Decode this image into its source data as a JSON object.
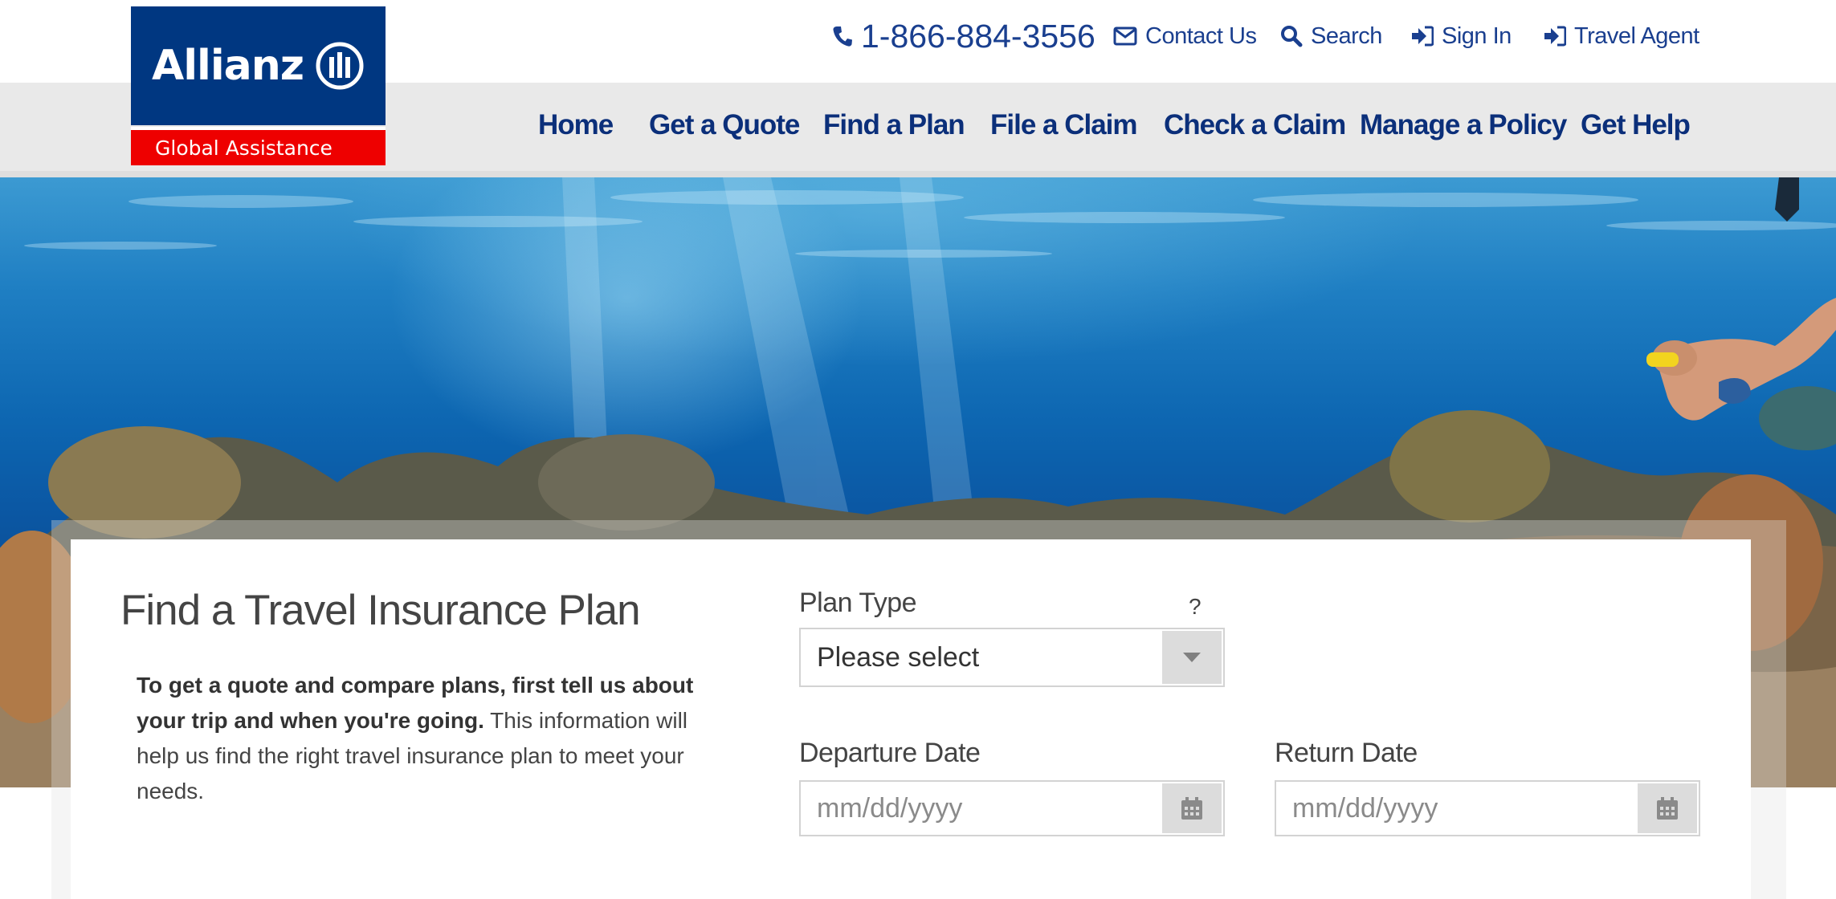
{
  "brand": {
    "name": "Allianz",
    "sub": "Global Assistance",
    "blue": "#003781",
    "red": "#ee0000"
  },
  "utility": {
    "phone": "1-866-884-3556",
    "contact": "Contact Us",
    "search": "Search",
    "sign_in": "Sign In",
    "travel_agent": "Travel Agent",
    "icons": [
      "phone-icon",
      "envelope-icon",
      "search-icon",
      "sign-in-icon",
      "sign-in-icon"
    ]
  },
  "nav": {
    "items": [
      "Home",
      "Get a Quote",
      "Find a Plan",
      "File a Claim",
      "Check a Claim",
      "Manage a Policy",
      "Get Help"
    ],
    "color": "#0b2f7a"
  },
  "form": {
    "title": "Find a Travel Insurance Plan",
    "desc_bold": "To get a quote and compare plans, first tell us about your trip and when you're going.",
    "desc_rest": " This information will help us find the right travel insurance plan to meet your needs.",
    "plan_type": {
      "label": "Plan Type",
      "help": "?",
      "value": "Please select"
    },
    "departure": {
      "label": "Departure Date",
      "placeholder": "mm/dd/yyyy"
    },
    "return": {
      "label": "Return Date",
      "placeholder": "mm/dd/yyyy"
    }
  }
}
